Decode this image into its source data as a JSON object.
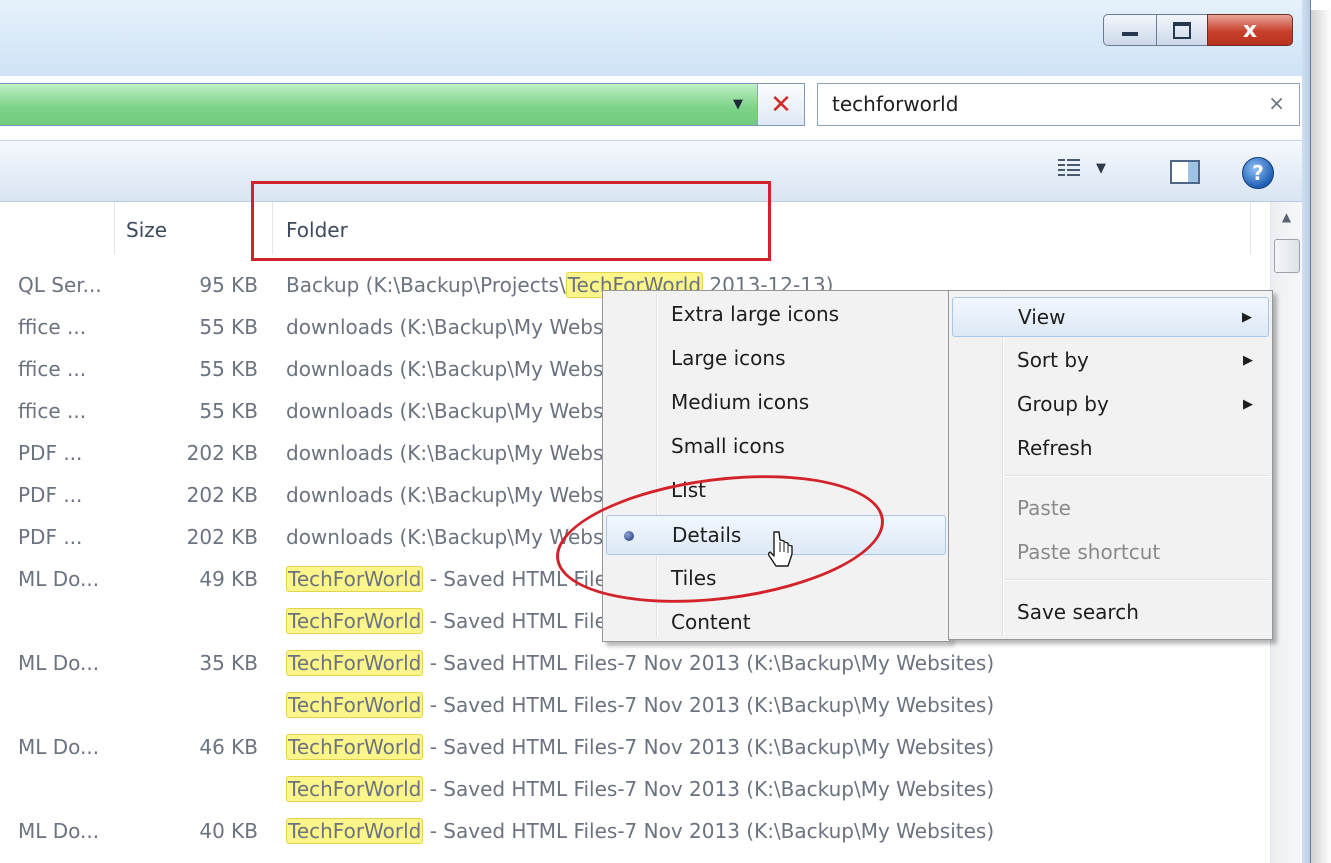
{
  "window": {
    "close_glyph": "x"
  },
  "address_bar": {
    "dropdown_glyph": "▼",
    "stop_glyph": "✕"
  },
  "search": {
    "value": "techforworld",
    "clear_glyph": "×"
  },
  "toolbar": {
    "help_glyph": "?",
    "views_caret": "▼"
  },
  "columns": {
    "size": "Size",
    "folder": "Folder"
  },
  "rows": [
    {
      "type": "QL Ser...",
      "size": "95 KB",
      "prefix": "Backup (K:\\Backup\\Projects\\",
      "highlight": "TechForWorld",
      "suffix": " 2013-12-13)"
    },
    {
      "type": "ffice ...",
      "size": "55 KB",
      "prefix": "downloads (K:\\Backup\\My Websites)",
      "highlight": "",
      "suffix": ""
    },
    {
      "type": "ffice ...",
      "size": "55 KB",
      "prefix": "downloads (K:\\Backup\\My Websites)",
      "highlight": "",
      "suffix": ""
    },
    {
      "type": "ffice ...",
      "size": "55 KB",
      "prefix": "downloads (K:\\Backup\\My Websites)",
      "highlight": "",
      "suffix": ""
    },
    {
      "type": "PDF ...",
      "size": "202 KB",
      "prefix": "downloads (K:\\Backup\\My Websites)",
      "highlight": "",
      "suffix": ""
    },
    {
      "type": "PDF ...",
      "size": "202 KB",
      "prefix": "downloads (K:\\Backup\\My Websites)",
      "highlight": "",
      "suffix": ""
    },
    {
      "type": "PDF ...",
      "size": "202 KB",
      "prefix": "downloads (K:\\Backup\\My Websites)",
      "highlight": "",
      "suffix": ""
    },
    {
      "type": "ML Do...",
      "size": "49 KB",
      "prefix": "",
      "highlight": "TechForWorld",
      "suffix": " - Saved HTML Files-7 Nov 2013 (K:\\Backup\\My Websites)"
    },
    {
      "type": "",
      "size": "",
      "prefix": "",
      "highlight": "TechForWorld",
      "suffix": " - Saved HTML Files-7 Nov 2013 (K:\\Backup\\My Websites)"
    },
    {
      "type": "ML Do...",
      "size": "35 KB",
      "prefix": "",
      "highlight": "TechForWorld",
      "suffix": " - Saved HTML Files-7 Nov 2013 (K:\\Backup\\My Websites)"
    },
    {
      "type": "",
      "size": "",
      "prefix": "",
      "highlight": "TechForWorld",
      "suffix": " - Saved HTML Files-7 Nov 2013 (K:\\Backup\\My Websites)"
    },
    {
      "type": "ML Do...",
      "size": "46 KB",
      "prefix": "",
      "highlight": "TechForWorld",
      "suffix": " - Saved HTML Files-7 Nov 2013 (K:\\Backup\\My Websites)"
    },
    {
      "type": "",
      "size": "",
      "prefix": "",
      "highlight": "TechForWorld",
      "suffix": " - Saved HTML Files-7 Nov 2013 (K:\\Backup\\My Websites)"
    },
    {
      "type": "ML Do...",
      "size": "40 KB",
      "prefix": "",
      "highlight": "TechForWorld",
      "suffix": " - Saved HTML Files-7 Nov 2013 (K:\\Backup\\My Websites)"
    }
  ],
  "view_submenu": {
    "items": [
      {
        "label": "Extra large icons"
      },
      {
        "label": "Large icons"
      },
      {
        "label": "Medium icons"
      },
      {
        "label": "Small icons"
      },
      {
        "label": "List"
      },
      {
        "label": "Details"
      },
      {
        "label": "Tiles"
      },
      {
        "label": "Content"
      }
    ],
    "selected": "Details"
  },
  "context_menu": {
    "items": [
      {
        "label": "View",
        "submenu": true,
        "arrow": "▶"
      },
      {
        "label": "Sort by",
        "submenu": true,
        "arrow": "▶"
      },
      {
        "label": "Group by",
        "submenu": true,
        "arrow": "▶"
      },
      {
        "label": "Refresh"
      },
      {
        "label": "Paste",
        "disabled": true
      },
      {
        "label": "Paste shortcut",
        "disabled": true
      },
      {
        "label": "Save search"
      }
    ]
  },
  "colors": {
    "address_bar_green": "#7ed48a",
    "annotation_red": "#d2232a",
    "search_highlight": "#fbf58a"
  }
}
